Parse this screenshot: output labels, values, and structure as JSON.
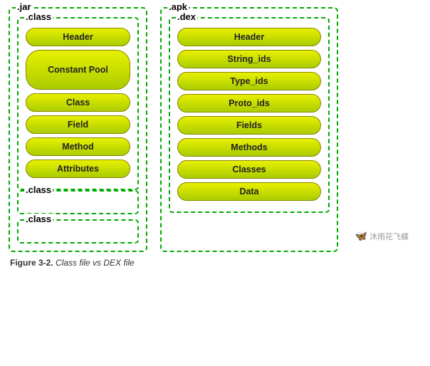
{
  "jar": {
    "label": ".jar",
    "class_section": {
      "label": ".class",
      "items": [
        {
          "id": "header",
          "text": "Header"
        },
        {
          "id": "constant-pool",
          "text": "Constant Pool"
        },
        {
          "id": "class",
          "text": "Class"
        },
        {
          "id": "field",
          "text": "Field"
        },
        {
          "id": "method",
          "text": "Method"
        },
        {
          "id": "attributes",
          "text": "Attributes"
        }
      ]
    },
    "class_small_1": {
      "label": ".class"
    },
    "class_small_2": {
      "label": ".class"
    }
  },
  "apk": {
    "label": ".apk",
    "dex_section": {
      "label": ".dex",
      "items": [
        {
          "id": "header",
          "text": "Header"
        },
        {
          "id": "string-ids",
          "text": "String_ids"
        },
        {
          "id": "type-ids",
          "text": "Type_ids"
        },
        {
          "id": "proto-ids",
          "text": "Proto_ids"
        },
        {
          "id": "fields",
          "text": "Fields"
        },
        {
          "id": "methods",
          "text": "Methods"
        },
        {
          "id": "classes",
          "text": "Classes"
        },
        {
          "id": "data",
          "text": "Data"
        }
      ]
    }
  },
  "caption": {
    "figure_label": "Figure 3-2.",
    "figure_text": "Class file vs DEX file"
  },
  "watermark": {
    "icon": "🦋",
    "text": "沐雨花飞蝶"
  }
}
